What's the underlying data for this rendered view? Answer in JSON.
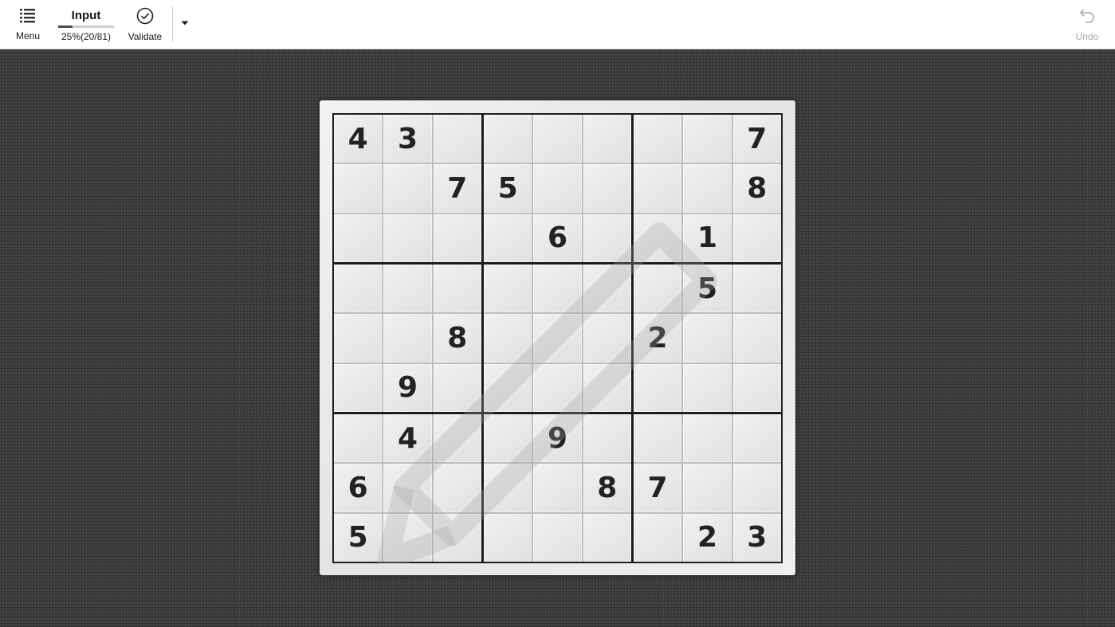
{
  "toolbar": {
    "menu_label": "Menu",
    "input_title": "Input",
    "progress_text": "25%(20/81)",
    "progress_fraction": 0.25,
    "validate_label": "Validate",
    "undo_label": "Undo",
    "icons": {
      "menu": "list-icon",
      "validate": "check-circle-icon",
      "dropdown": "caret-down-icon",
      "undo": "undo-icon"
    }
  },
  "board": {
    "cells": [
      [
        "4",
        "3",
        "",
        "",
        "",
        "",
        "",
        "",
        "7"
      ],
      [
        "",
        "",
        "7",
        "5",
        "",
        "",
        "",
        "",
        "8"
      ],
      [
        "",
        "",
        "",
        "",
        "6",
        "",
        "",
        "1",
        ""
      ],
      [
        "",
        "",
        "",
        "",
        "",
        "",
        "",
        "5",
        ""
      ],
      [
        "",
        "",
        "8",
        "",
        "",
        "",
        "2",
        "",
        ""
      ],
      [
        "",
        "9",
        "",
        "",
        "",
        "",
        "",
        "",
        ""
      ],
      [
        "",
        "4",
        "",
        "",
        "9",
        "",
        "",
        "",
        ""
      ],
      [
        "6",
        "",
        "",
        "",
        "",
        "8",
        "7",
        "",
        ""
      ],
      [
        "5",
        "",
        "",
        "",
        "",
        "",
        "",
        "2",
        "3"
      ]
    ]
  },
  "colors": {
    "background": "#3c3c3c",
    "digit": "#222222",
    "grid_line": "#1c1c1c"
  }
}
